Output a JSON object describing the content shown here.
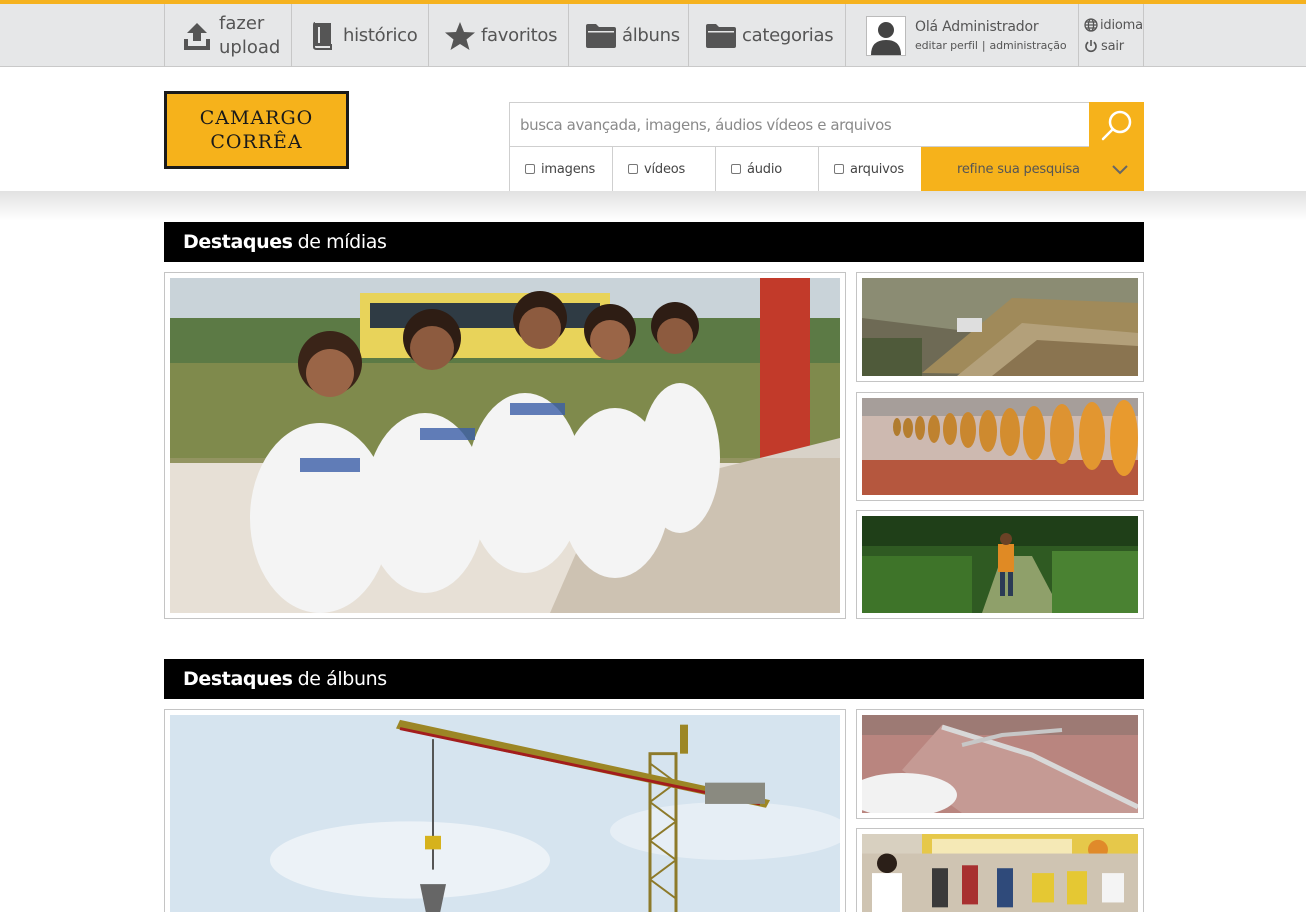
{
  "nav": {
    "upload_line1": "fazer",
    "upload_line2": "upload",
    "history": "histórico",
    "favorites": "favoritos",
    "albums": "álbuns",
    "categories": "categorias",
    "greeting": "Olá Administrador",
    "edit_profile": "editar perfil",
    "separator": "|",
    "admin": "administração",
    "language": "idioma",
    "logout": "sair"
  },
  "logo": {
    "line1": "CAMARGO",
    "line2": "CORRÊA"
  },
  "search": {
    "placeholder": "busca avançada, imagens, áudios vídeos e arquivos",
    "filters": [
      "imagens",
      "vídeos",
      "áudio",
      "arquivos"
    ],
    "refine": "refine sua pesquisa"
  },
  "sections": {
    "media": {
      "strong": "Destaques",
      "rest": "de mídias"
    },
    "albums": {
      "strong": "Destaques",
      "rest": "de álbuns"
    }
  },
  "colors": {
    "accent": "#f6b21b",
    "nav_bg": "#e6e7e8",
    "title_bar": "#000000"
  },
  "icons": [
    "upload-icon",
    "book-icon",
    "star-icon",
    "folder-icon",
    "user-icon",
    "globe-icon",
    "power-icon",
    "search-icon",
    "chevron-down-icon"
  ]
}
